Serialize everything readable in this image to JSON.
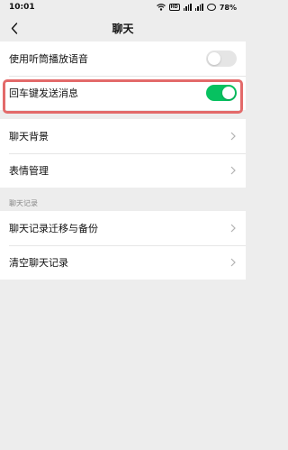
{
  "status_bar": {
    "time": "10:01",
    "battery": "78%"
  },
  "nav": {
    "title": "聊天"
  },
  "group1": {
    "items": [
      {
        "label": "使用听筒播放语音",
        "type": "toggle",
        "on": false
      },
      {
        "label": "回车键发送消息",
        "type": "toggle",
        "on": true
      }
    ]
  },
  "group2": {
    "items": [
      {
        "label": "聊天背景",
        "type": "link"
      },
      {
        "label": "表情管理",
        "type": "link"
      }
    ]
  },
  "chat_history": {
    "header": "聊天记录",
    "items": [
      {
        "label": "聊天记录迁移与备份",
        "type": "link"
      },
      {
        "label": "清空聊天记录",
        "type": "link"
      }
    ]
  },
  "colors": {
    "toggle_on": "#07c160",
    "toggle_off": "#e5e5e5",
    "highlight": "#e36a6a",
    "background": "#ededed"
  },
  "icons": [
    "back-icon",
    "wifi-icon",
    "signal-icon",
    "battery-icon",
    "chevron-right-icon"
  ]
}
